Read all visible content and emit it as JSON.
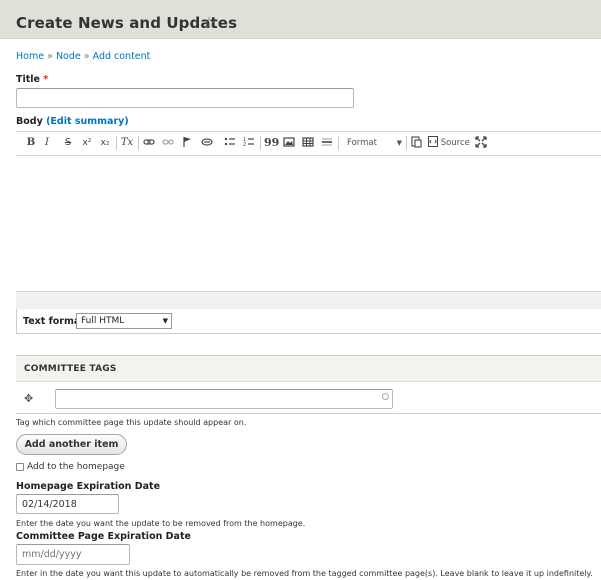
{
  "page": {
    "title": "Create News and Updates",
    "star_icon": "☆"
  },
  "breadcrumb": {
    "items": [
      "Home",
      "Node",
      "Add content"
    ],
    "separator": "»"
  },
  "title_field": {
    "label": "Title",
    "required_marker": "*",
    "value": ""
  },
  "body_field": {
    "label": "Body",
    "edit_summary_open": "(",
    "edit_summary_link": "Edit summary",
    "edit_summary_close": ")",
    "toolbar": {
      "bold": "B",
      "italic": "I",
      "strike": "S",
      "superscript": "x²",
      "subscript": "x₂",
      "remove_format": "Tx",
      "blockquote": "99",
      "format_label": "Format",
      "source_label": "Source"
    }
  },
  "text_format": {
    "label": "Text format",
    "selected": "Full HTML"
  },
  "committee_tags": {
    "title": "COMMITTEE TAGS",
    "input_value": "",
    "description": "Tag which committee page this update should appear on."
  },
  "add_another_button": "Add another item",
  "homepage_checkbox": {
    "label": "Add to the homepage",
    "checked": false
  },
  "homepage_expiration": {
    "label": "Homepage Expiration Date",
    "value": "02/14/2018",
    "description": "Enter the date you want the update to be removed from the homepage."
  },
  "committee_expiration": {
    "label": "Committee Page Expiration Date",
    "placeholder": "mm/dd/yyyy",
    "description": "Enter in the date you want this update to automatically be removed from the tagged committee page(s). Leave blank to leave it up indefinitely."
  },
  "colors": {
    "header_bg": "#e0e0d8",
    "link": "#0074bd",
    "required": "#e32700"
  }
}
